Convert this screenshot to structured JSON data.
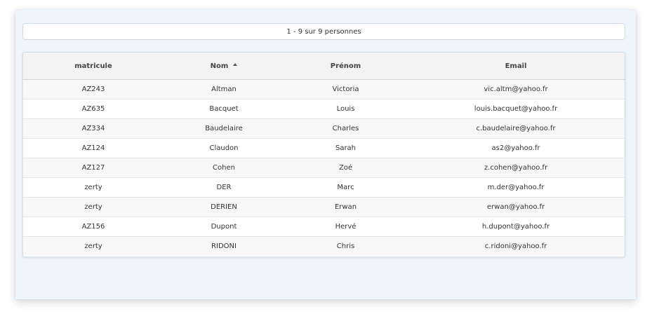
{
  "pager": {
    "text": "1 - 9 sur 9 personnes"
  },
  "table": {
    "columns": [
      {
        "label": "matricule"
      },
      {
        "label": "Nom"
      },
      {
        "label": "Prénom"
      },
      {
        "label": "Email"
      }
    ],
    "sort": {
      "column": "Nom",
      "direction": "ascending",
      "icon": "sort-ascending-icon"
    },
    "rows": [
      [
        "AZ243",
        "Altman",
        "Victoria",
        "vic.altm@yahoo.fr"
      ],
      [
        "AZ635",
        "Bacquet",
        "Louis",
        "louis.bacquet@yahoo.fr"
      ],
      [
        "AZ334",
        "Baudelaire",
        "Charles",
        "c.baudelaire@yahoo.fr"
      ],
      [
        "AZ124",
        "Claudon",
        "Sarah",
        "as2@yahoo.fr"
      ],
      [
        "AZ127",
        "Cohen",
        "Zoé",
        "z.cohen@yahoo.fr"
      ],
      [
        "zerty",
        "DER",
        "Marc",
        "m.der@yahoo.fr"
      ],
      [
        "zerty",
        "DERIEN",
        "Erwan",
        "erwan@yahoo.fr"
      ],
      [
        "AZ156",
        "Dupont",
        "Hervé",
        "h.dupont@yahoo.fr"
      ],
      [
        "zerty",
        "RIDONI",
        "Chris",
        "c.ridoni@yahoo.fr"
      ]
    ]
  },
  "colors": {
    "panel_background": "#eff5fd",
    "header_background": "#f3f3f3",
    "row_stripe": "#f8f8f8"
  }
}
